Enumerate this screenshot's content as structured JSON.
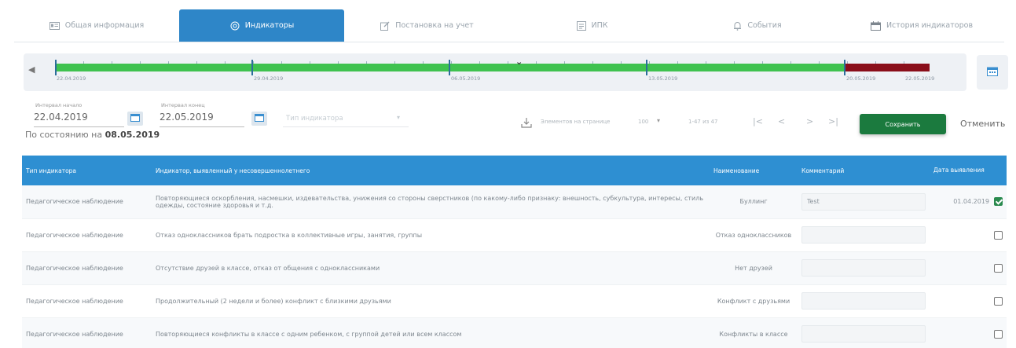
{
  "tabs": [
    {
      "label": "Общая информация",
      "icon": "id-card-icon",
      "active": false
    },
    {
      "label": "Индикаторы",
      "icon": "target-icon",
      "active": true
    },
    {
      "label": "Постановка на учет",
      "icon": "edit-icon",
      "active": false
    },
    {
      "label": "ИПК",
      "icon": "document-icon",
      "active": false
    },
    {
      "label": "События",
      "icon": "bell-icon",
      "active": false
    },
    {
      "label": "История индикаторов",
      "icon": "calendar-icon",
      "active": false
    }
  ],
  "timeline": {
    "labels": [
      "22.04.2019",
      "29.04.2019",
      "06.05.2019",
      "13.05.2019",
      "20.05.2019",
      "22.05.2019"
    ],
    "colors": {
      "normal": "#3fc24f",
      "alert": "#8a0e1a"
    }
  },
  "filters": {
    "start_label": "Интервал начало",
    "start_value": "22.04.2019",
    "end_label": "Интервал конец",
    "end_value": "22.05.2019",
    "type_placeholder": "Тип индикатора"
  },
  "state": {
    "prefix": "По состоянию на",
    "date": "08.05.2019"
  },
  "pagination": {
    "per_page_label": "Элементов на странице",
    "per_page_value": "100",
    "range_text": "1-47 из 47",
    "nav": [
      "|<",
      "<",
      ">",
      ">|"
    ]
  },
  "actions": {
    "save_label": "Сохранить",
    "cancel_label": "Отменить"
  },
  "table": {
    "headers": {
      "type": "Тип индикатора",
      "indicator": "Индикатор, выявленный у несовершеннолетнего",
      "name": "Наименование",
      "comment": "Комментарий",
      "date": "Дата выявления"
    },
    "rows": [
      {
        "type": "Педагогическое наблюдение",
        "indicator": "Повторяющиеся оскорбления, насмешки, издевательства, унижения со стороны сверстников (по какому-либо признаку: внешность, субкультура, интересы, стиль одежды, состояние здоровья и т.д.",
        "name": "Буллинг",
        "comment": "Test",
        "date": "01.04.2019",
        "checked": true
      },
      {
        "type": "Педагогическое наблюдение",
        "indicator": "Отказ одноклассников брать подростка в коллективные игры, занятия, группы",
        "name": "Отказ одноклассников",
        "comment": "",
        "date": "",
        "checked": false
      },
      {
        "type": "Педагогическое наблюдение",
        "indicator": "Отсутствие друзей в классе, отказ от общения с одноклассниками",
        "name": "Нет друзей",
        "comment": "",
        "date": "",
        "checked": false
      },
      {
        "type": "Педагогическое наблюдение",
        "indicator": "Продолжительный (2 недели и более) конфликт с близкими друзьями",
        "name": "Конфликт с друзьями",
        "comment": "",
        "date": "",
        "checked": false
      },
      {
        "type": "Педагогическое наблюдение",
        "indicator": "Повторяющиеся конфликты в классе с одним ребенком, с группой детей или всем классом",
        "name": "Конфликты в классе",
        "comment": "",
        "date": "",
        "checked": false
      }
    ]
  }
}
